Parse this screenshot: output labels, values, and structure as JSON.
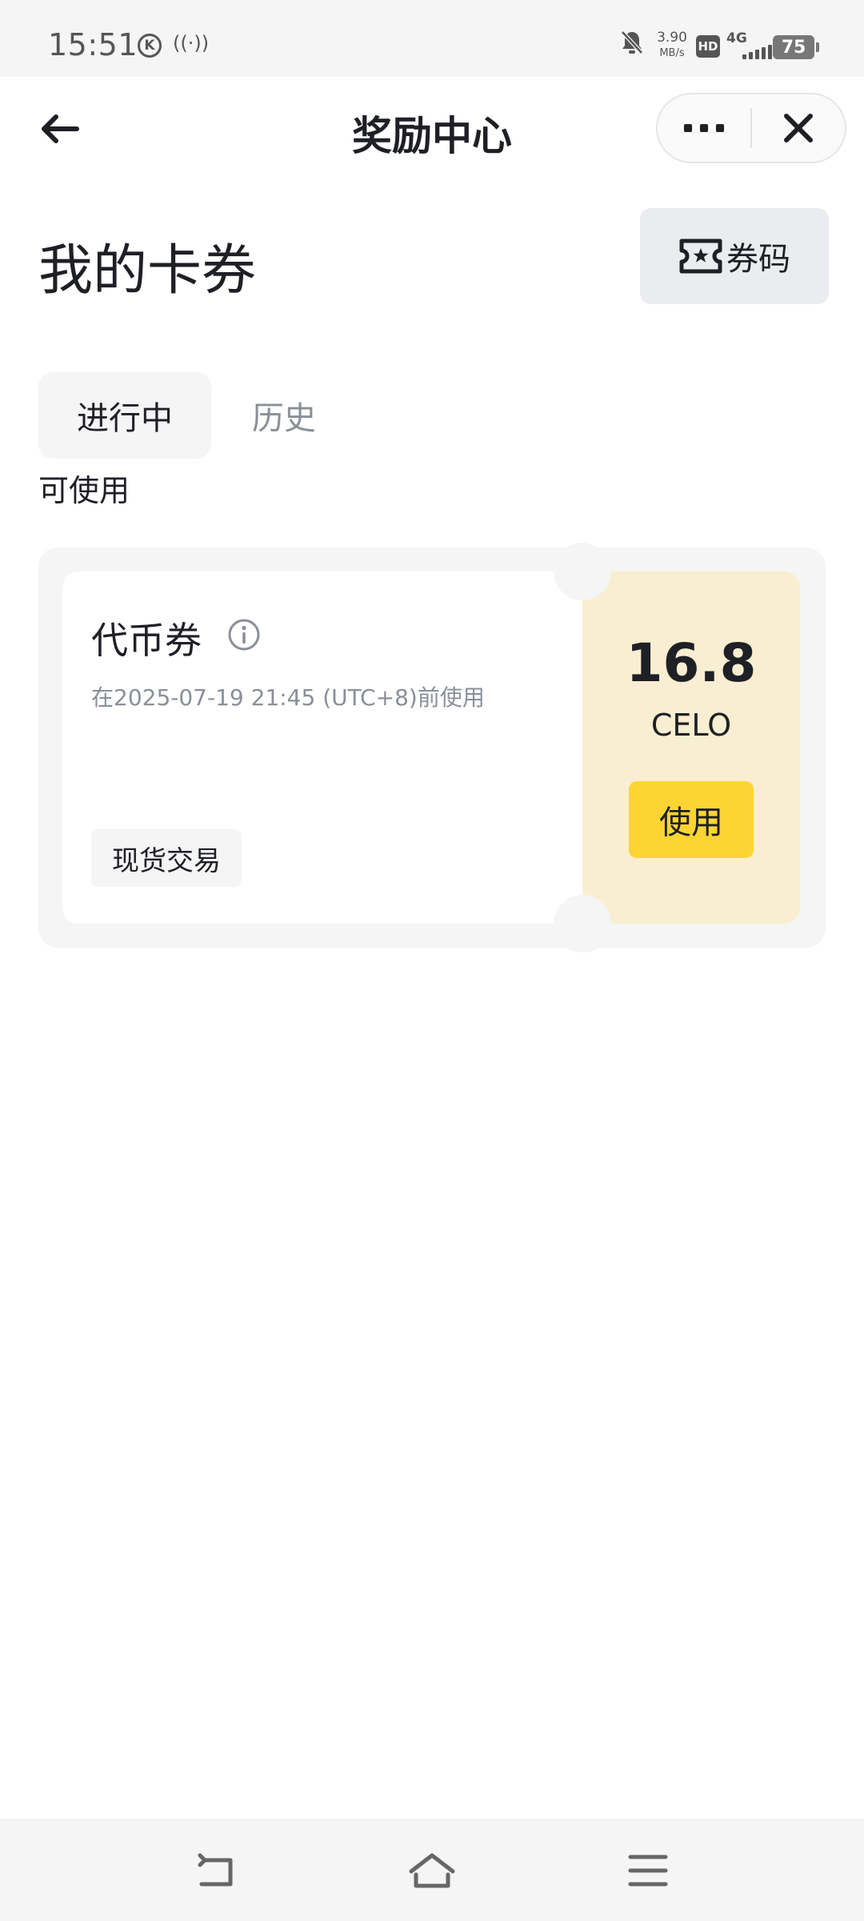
{
  "status_bar": {
    "time": "15:51",
    "k_badge": "K",
    "net_speed_value": "3.90",
    "net_speed_unit": "MB/s",
    "hd": "HD",
    "network": "4G",
    "battery": "75"
  },
  "header": {
    "title": "奖励中心",
    "back_icon": "arrow-left-icon",
    "more_icon": "more-dots-icon",
    "close_icon": "close-icon"
  },
  "page": {
    "title": "我的卡券",
    "code_button_label": "券码"
  },
  "tabs": [
    {
      "label": "进行中",
      "active": true
    },
    {
      "label": "历史",
      "active": false
    }
  ],
  "section_label": "可使用",
  "coupon": {
    "name": "代币券",
    "expire_text": "在2025-07-19 21:45 (UTC+8)前使用",
    "tag": "现货交易",
    "amount": "16.8",
    "unit": "CELO",
    "use_label": "使用"
  },
  "colors": {
    "accent": "#fcd535",
    "coupon_panel": "#f9eed1",
    "text_primary": "#1e2026",
    "text_secondary": "#8a8f98"
  }
}
